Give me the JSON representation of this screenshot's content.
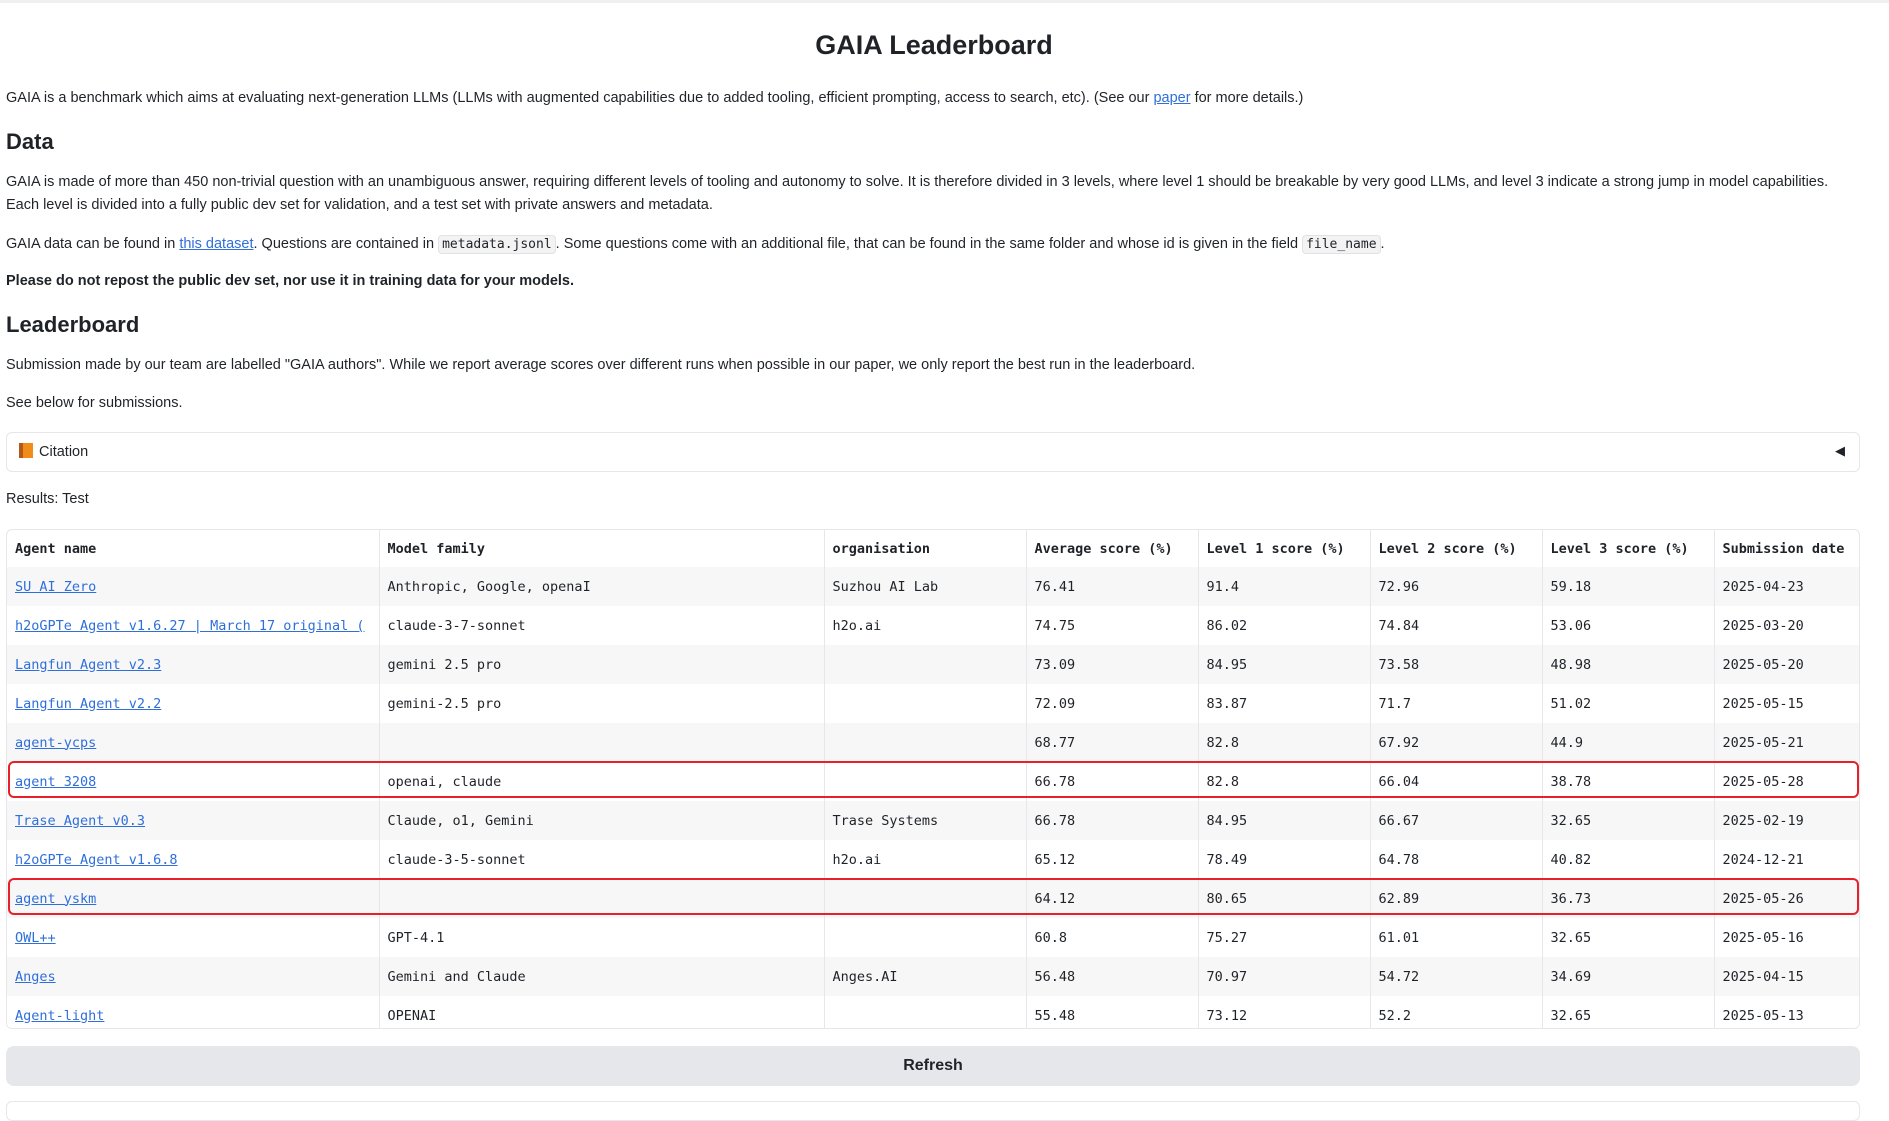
{
  "page": {
    "title": "GAIA Leaderboard",
    "intro": {
      "before": "GAIA is a benchmark which aims at evaluating next-generation LLMs (LLMs with augmented capabilities due to added tooling, efficient prompting, access to search, etc). (See our ",
      "link": "paper",
      "after": " for more details.)"
    },
    "data_heading": "Data",
    "data_p1": "GAIA is made of more than 450 non-trivial question with an unambiguous answer, requiring different levels of tooling and autonomy to solve. It is therefore divided in 3 levels, where level 1 should be breakable by very good LLMs, and level 3 indicate a strong jump in model capabilities. Each level is divided into a fully public dev set for validation, and a test set with private answers and metadata.",
    "data_p2": {
      "t1": "GAIA data can be found in ",
      "link": "this dataset",
      "t2": ". Questions are contained in ",
      "code1": "metadata.jsonl",
      "t3": ". Some questions come with an additional file, that can be found in the same folder and whose id is given in the field ",
      "code2": "file_name",
      "t4": "."
    },
    "warning": "Please do not repost the public dev set, nor use it in training data for your models.",
    "leaderboard_heading": "Leaderboard",
    "lb_p1": "Submission made by our team are labelled \"GAIA authors\". While we report average scores over different runs when possible in our paper, we only report the best run in the leaderboard.",
    "lb_p2": "See below for submissions.",
    "citation_label": "Citation",
    "citation_toggle": "◀",
    "results_label": "Results: Test",
    "refresh_label": "Refresh"
  },
  "table": {
    "columns": [
      "Agent name",
      "Model family",
      "organisation",
      "Average score (%)",
      "Level 1 score (%)",
      "Level 2 score (%)",
      "Level 3 score (%)",
      "Submission date"
    ],
    "rows": [
      [
        "SU AI Zero",
        "Anthropic, Google, openaI",
        "Suzhou AI Lab",
        "76.41",
        "91.4",
        "72.96",
        "59.18",
        "2025-04-23"
      ],
      [
        "h2oGPTe Agent v1.6.27 | March 17 original (",
        "claude-3-7-sonnet",
        "h2o.ai",
        "74.75",
        "86.02",
        "74.84",
        "53.06",
        "2025-03-20"
      ],
      [
        "Langfun Agent v2.3",
        "gemini 2.5 pro",
        "",
        "73.09",
        "84.95",
        "73.58",
        "48.98",
        "2025-05-20"
      ],
      [
        "Langfun Agent v2.2",
        "gemini-2.5 pro",
        "",
        "72.09",
        "83.87",
        "71.7",
        "51.02",
        "2025-05-15"
      ],
      [
        "agent-ycps",
        "",
        "",
        "68.77",
        "82.8",
        "67.92",
        "44.9",
        "2025-05-21"
      ],
      [
        "agent 3208",
        "openai, claude",
        "",
        "66.78",
        "82.8",
        "66.04",
        "38.78",
        "2025-05-28"
      ],
      [
        "Trase Agent v0.3",
        "Claude, o1, Gemini",
        "Trase Systems",
        "66.78",
        "84.95",
        "66.67",
        "32.65",
        "2025-02-19"
      ],
      [
        "h2oGPTe Agent v1.6.8",
        "claude-3-5-sonnet",
        "h2o.ai",
        "65.12",
        "78.49",
        "64.78",
        "40.82",
        "2024-12-21"
      ],
      [
        "agent yskm",
        "",
        "",
        "64.12",
        "80.65",
        "62.89",
        "36.73",
        "2025-05-26"
      ],
      [
        "OWL++",
        "GPT-4.1",
        "",
        "60.8",
        "75.27",
        "61.01",
        "32.65",
        "2025-05-16"
      ],
      [
        "Anges",
        "Gemini and Claude",
        "Anges.AI",
        "56.48",
        "70.97",
        "54.72",
        "34.69",
        "2025-04-15"
      ],
      [
        "Agent-light",
        "OPENAI",
        "",
        "55.48",
        "73.12",
        "52.2",
        "32.65",
        "2025-05-13"
      ]
    ],
    "highlighted_rows": [
      "agent 3208",
      "agent yskm"
    ]
  },
  "colors": {
    "link": "#2f6fdb",
    "highlight": "#e8202a",
    "button_bg": "#e5e7eb"
  }
}
